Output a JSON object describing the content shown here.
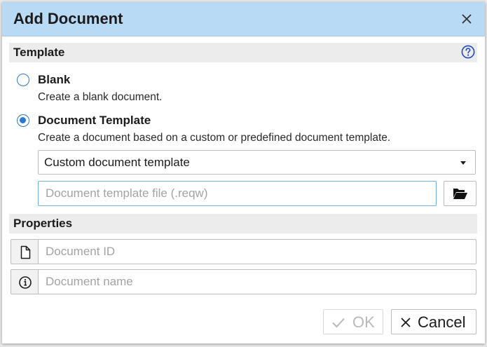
{
  "dialog": {
    "title": "Add Document"
  },
  "template_section": {
    "label": "Template",
    "options": [
      {
        "label": "Blank",
        "description": "Create a blank document.",
        "checked": false
      },
      {
        "label": "Document Template",
        "description": "Create a document based on a custom or predefined document template.",
        "checked": true
      }
    ],
    "template_type": {
      "selected": "Custom document template"
    },
    "file_input": {
      "value": "",
      "placeholder": "Document template file (.reqw)"
    }
  },
  "properties_section": {
    "label": "Properties",
    "document_id": {
      "value": "",
      "placeholder": "Document ID"
    },
    "document_name": {
      "value": "",
      "placeholder": "Document name"
    }
  },
  "footer": {
    "ok_label": "OK",
    "cancel_label": "Cancel"
  },
  "icons": {
    "close": "close-icon",
    "help": "help-circle-icon",
    "browse": "folder-open-icon",
    "doc_id": "file-icon",
    "doc_name": "info-icon",
    "ok": "check-icon",
    "cancel": "x-icon"
  },
  "colors": {
    "titlebar": "#b9daf5",
    "accent": "#2a78d6",
    "section_bg": "#ececec",
    "focus_border": "#6fb3d9"
  }
}
